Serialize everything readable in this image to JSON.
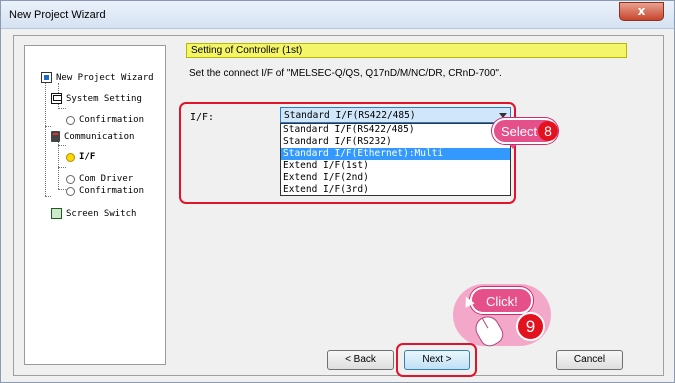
{
  "window": {
    "title": "New Project Wizard",
    "close_label": "x"
  },
  "tree": {
    "items": [
      {
        "label": "New Project Wizard",
        "icon": "wizard-icon"
      },
      {
        "label": "System Setting",
        "icon": "system-setting-icon"
      },
      {
        "label": "Confirmation",
        "icon": "bulb-icon"
      },
      {
        "label": "Communication",
        "icon": "communication-icon"
      },
      {
        "label": "I/F",
        "icon": "bulb-icon-active",
        "selected": true
      },
      {
        "label": "Com Driver",
        "icon": "bulb-icon"
      },
      {
        "label": "Confirmation",
        "icon": "bulb-icon"
      },
      {
        "label": "Screen Switch",
        "icon": "screen-switch-icon"
      }
    ]
  },
  "section": {
    "title": "Setting of Controller (1st)",
    "instruction": "Set the connect I/F of \"MELSEC-Q/QS, Q17nD/M/NC/DR, CRnD-700\"."
  },
  "interface": {
    "label": "I/F:",
    "selected_value": "Standard I/F(RS422/485)",
    "options": [
      "Standard I/F(RS422/485)",
      "Standard I/F(RS232)",
      "Standard I/F(Ethernet):Multi",
      "Extend I/F(1st)",
      "Extend I/F(2nd)",
      "Extend I/F(3rd)"
    ],
    "highlighted_option_index": 2
  },
  "callouts": {
    "select_text": "Select",
    "select_step": "8",
    "click_text": "Click!",
    "click_step": "9"
  },
  "buttons": {
    "back": "< Back",
    "next": "Next >",
    "cancel": "Cancel"
  },
  "colors": {
    "section_bar": "#f5f56a",
    "highlight_border": "#e0142a",
    "callout": "#e5508a",
    "selected_option": "#3399ff"
  }
}
